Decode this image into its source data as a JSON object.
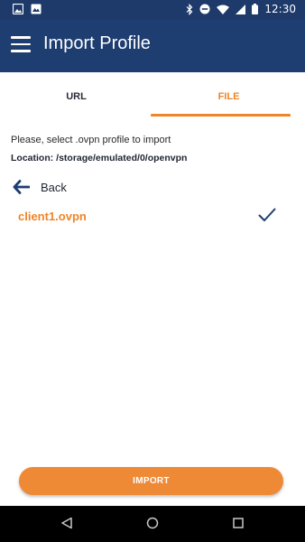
{
  "status_bar": {
    "time": "12:30",
    "icons": [
      "image-icon",
      "photo-icon",
      "bluetooth-icon",
      "do-not-disturb-icon",
      "wifi-icon",
      "signal-icon",
      "battery-icon"
    ]
  },
  "app_bar": {
    "title": "Import Profile",
    "menu_icon": "hamburger-menu-icon"
  },
  "tabs": [
    {
      "label": "URL",
      "selected": false
    },
    {
      "label": "FILE",
      "selected": true
    }
  ],
  "content": {
    "prompt": "Please, select .ovpn profile to import",
    "location": "Location: /storage/emulated/0/openvpn",
    "back_label": "Back",
    "files": [
      {
        "name": "client1.ovpn",
        "selected": true
      }
    ]
  },
  "import_button": {
    "label": "IMPORT"
  },
  "colors": {
    "primary": "#1e3d70",
    "accent": "#ef8428",
    "text": "#1e2430"
  },
  "nav_bar": {
    "icons": [
      "back-triangle-icon",
      "home-circle-icon",
      "recents-square-icon"
    ]
  }
}
